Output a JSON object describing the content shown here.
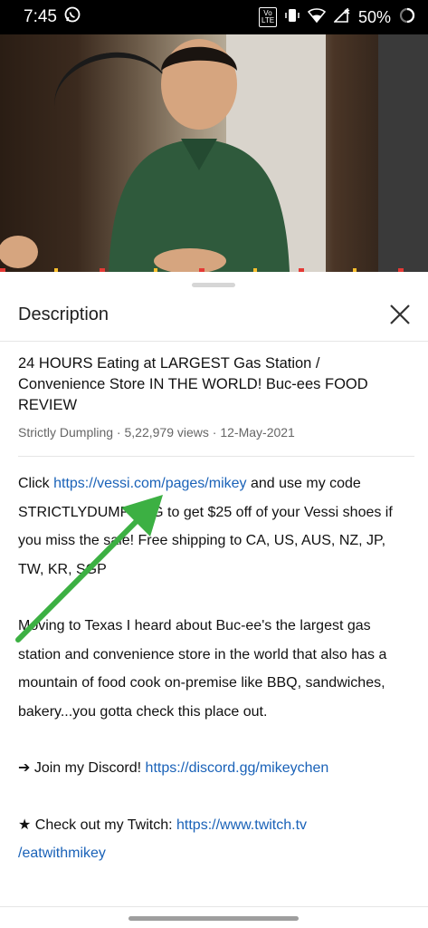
{
  "status": {
    "time": "7:45",
    "volte": "Vo LTE",
    "battery": "50%"
  },
  "sheet": {
    "title": "Description"
  },
  "video": {
    "title": "24 HOURS Eating at LARGEST Gas Station / Convenience Store IN THE WORLD!  Buc-ees FOOD REVIEW",
    "channel": "Strictly Dumpling",
    "views": "5,22,979 views",
    "date": "12-May-2021",
    "sep": " · "
  },
  "description": {
    "p1_pre": "Click ",
    "p1_link": "https://vessi.com/pages/mikey",
    "p1_post": " and use my code STRICTLYDUMPLING to get $25 off of your Vessi shoes if you miss the sale! Free shipping to CA, US, AUS, NZ, JP, TW, KR, SGP",
    "p2": "Moving to Texas I heard about Buc-ee's the largest gas station and convenience store in the world that also has a mountain of food cook on-premise like BBQ, sandwiches, bakery...you gotta check this place out.",
    "p3_pre": "➔ Join my Discord! ",
    "p3_link": "https://discord.gg/mikeychen",
    "p4_pre": "★ Check out my Twitch: ",
    "p4_link_a": "https://www.twitch.tv",
    "p4_link_b": "/eatwithmikey"
  },
  "colors": {
    "link": "#1a62b8",
    "arrow": "#3cb043"
  }
}
